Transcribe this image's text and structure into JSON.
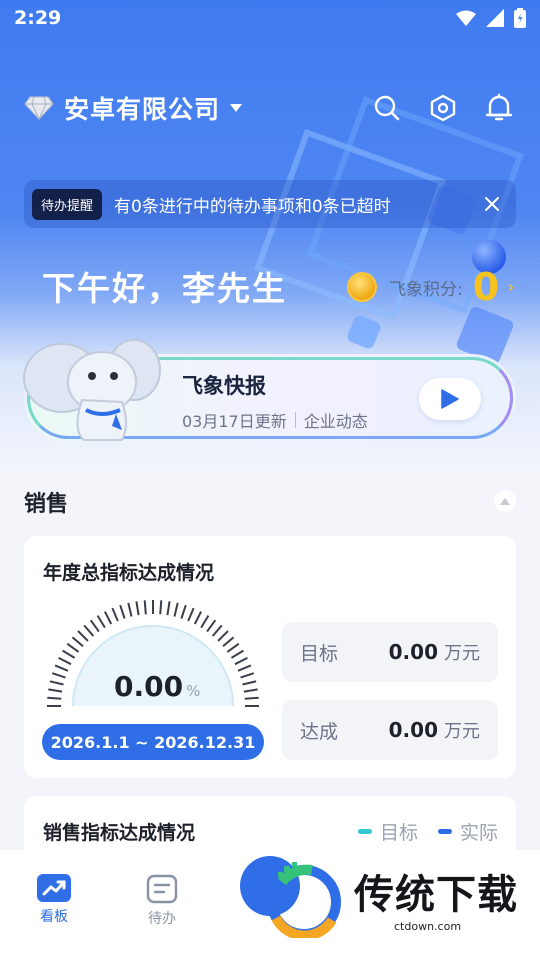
{
  "status_bar": {
    "time": "2:29"
  },
  "header": {
    "company_name": "安卓有限公司"
  },
  "notice": {
    "tag": "待办提醒",
    "text": "有0条进行中的待办事项和0条已超时"
  },
  "greeting": "下午好，李先生",
  "points": {
    "label": "飞象积分:",
    "value": "0",
    "arrow": "›"
  },
  "news": {
    "title": "飞象快报",
    "date": "03月17日更新",
    "category": "企业动态"
  },
  "section": {
    "title": "销售"
  },
  "annual_card": {
    "title": "年度总指标达成情况",
    "percent": "0.00",
    "percent_unit": "%",
    "date_range": "2026.1.1 ~ 2026.12.31",
    "target_label": "目标",
    "target_value": "0.00",
    "target_unit": "万元",
    "achieved_label": "达成",
    "achieved_value": "0.00",
    "achieved_unit": "万元"
  },
  "sales_card": {
    "title": "销售指标达成情况",
    "legend_target": "目标",
    "legend_actual": "实际",
    "legend_target_color": "#33c7d6",
    "legend_actual_color": "#2f6ee6"
  },
  "nav": {
    "dashboard": "看板",
    "todo": "待办"
  },
  "watermark": {
    "text": "传统下载",
    "url": "ctdown.com"
  }
}
